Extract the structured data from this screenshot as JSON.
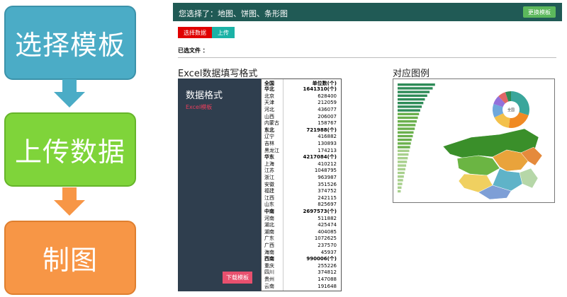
{
  "flow": {
    "steps": [
      {
        "label": "选择模板",
        "color": "#4bacc6"
      },
      {
        "label": "上传数据",
        "color": "#7fd43a"
      },
      {
        "label": "制图",
        "color": "#f79646"
      }
    ],
    "arrow_colors": [
      "#4bacc6",
      "#f79646"
    ]
  },
  "app": {
    "header_title": "您选择了：地图、饼图、条形图",
    "change_template_label": "更换模板",
    "select_data_label": "选择数据",
    "upload_label": "上传",
    "selected_files_label": "已选文件 ："
  },
  "excel_section": {
    "title": "Excel数据填写格式",
    "panel_title": "数据格式",
    "template_link": "Excel模板",
    "download_label": "下载模板",
    "table": {
      "headers": [
        "全国",
        "单位数(个)"
      ],
      "rows": [
        [
          "华北",
          "1641310(个)",
          true
        ],
        [
          "北京",
          "628400",
          false
        ],
        [
          "天津",
          "212059",
          false
        ],
        [
          "河北",
          "436077",
          false
        ],
        [
          "山西",
          "206007",
          false
        ],
        [
          "内蒙古",
          "158767",
          false
        ],
        [
          "东北",
          "721988(个)",
          true
        ],
        [
          "辽宁",
          "416882",
          false
        ],
        [
          "吉林",
          "130893",
          false
        ],
        [
          "黑龙江",
          "174213",
          false
        ],
        [
          "华东",
          "4217084(个)",
          true
        ],
        [
          "上海",
          "410212",
          false
        ],
        [
          "江苏",
          "1048795",
          false
        ],
        [
          "浙江",
          "963987",
          false
        ],
        [
          "安徽",
          "351526",
          false
        ],
        [
          "福建",
          "374752",
          false
        ],
        [
          "江西",
          "242115",
          false
        ],
        [
          "山东",
          "825697",
          false
        ],
        [
          "中南",
          "2697573(个)",
          true
        ],
        [
          "河南",
          "511882",
          false
        ],
        [
          "湖北",
          "425474",
          false
        ],
        [
          "湖南",
          "404085",
          false
        ],
        [
          "广东",
          "1072625",
          false
        ],
        [
          "广西",
          "237570",
          false
        ],
        [
          "海南",
          "45937",
          false
        ],
        [
          "西南",
          "990006(个)",
          true
        ],
        [
          "重庆",
          "255226",
          false
        ],
        [
          "四川",
          "374812",
          false
        ],
        [
          "贵州",
          "147088",
          false
        ],
        [
          "云南",
          "191648",
          false
        ]
      ]
    }
  },
  "chart_section": {
    "title": "对应图例",
    "pie_center_label": "全国",
    "bar_colors": [
      "#2e8b57",
      "#6ab04c",
      "#a8d08d"
    ],
    "pie_colors": [
      "#3aa69b",
      "#f08a24",
      "#f3c14b",
      "#6fa8dc",
      "#9370db",
      "#e06666",
      "#2e8b57"
    ],
    "map_colors": [
      "#3a8f2a",
      "#6bb543",
      "#e9a33b",
      "#f0d060",
      "#5fb3c8",
      "#7e9fd6",
      "#e58a3c",
      "#b6d7a8"
    ]
  }
}
